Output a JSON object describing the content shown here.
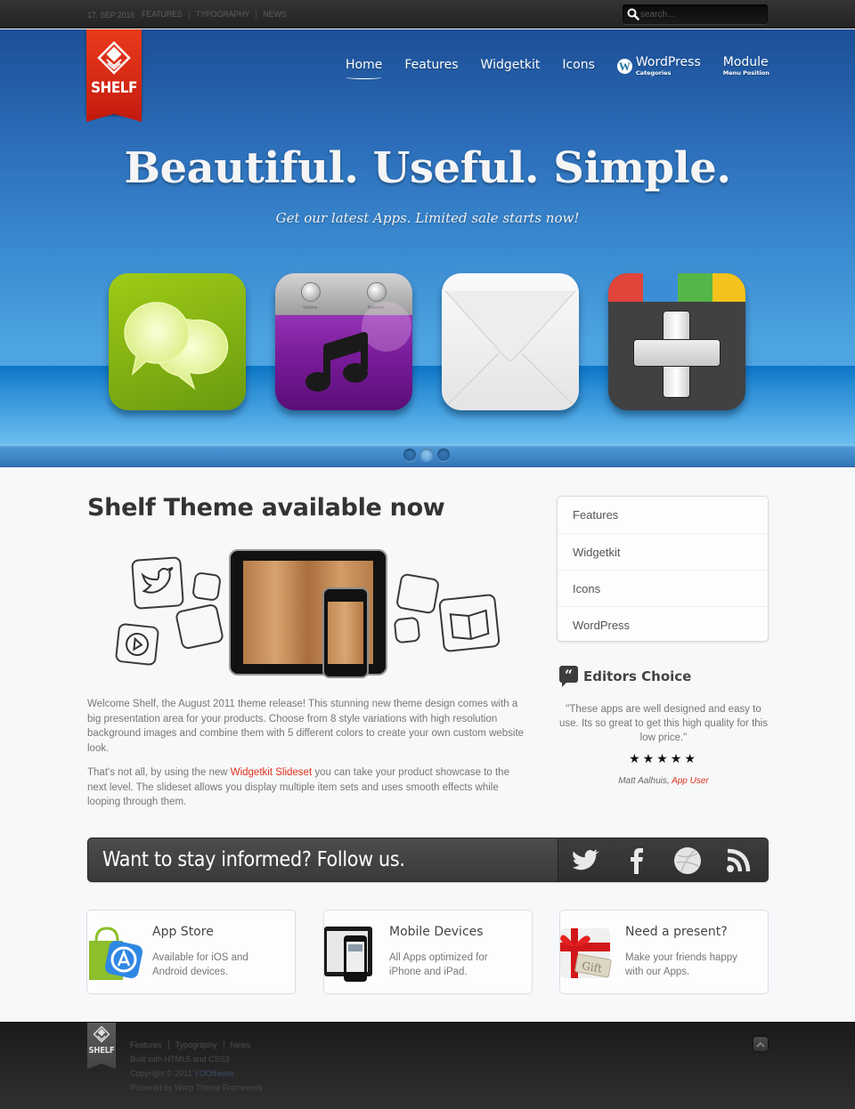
{
  "toolbar": {
    "date": "17. SEP 2016",
    "links": [
      "FEATURES",
      "TYPOGRAPHY",
      "NEWS"
    ],
    "search_placeholder": "search..."
  },
  "logo": {
    "text": "SHELF"
  },
  "nav": {
    "items": [
      {
        "label": "Home",
        "active": true
      },
      {
        "label": "Features"
      },
      {
        "label": "Widgetkit"
      },
      {
        "label": "Icons"
      },
      {
        "label": "WordPress",
        "sub": "Categories",
        "icon": "wordpress-icon"
      },
      {
        "label": "Module",
        "sub": "Menu Position"
      }
    ]
  },
  "hero": {
    "headline": "Beautiful. Useful. Simple.",
    "subline": "Get our latest Apps. Limited sale starts now!",
    "apps": [
      {
        "name": "messages",
        "icon": "speech-bubbles-icon"
      },
      {
        "name": "music",
        "icon": "music-note-icon",
        "knob_labels": [
          "Volume",
          "Balance"
        ]
      },
      {
        "name": "mail",
        "icon": "envelope-icon"
      },
      {
        "name": "google-plus",
        "icon": "plus-icon",
        "bar_colors": [
          "#e0443a",
          "#3b8ed6",
          "#54b548",
          "#f3c21c"
        ]
      }
    ],
    "slides": 3,
    "active_slide": 2
  },
  "main": {
    "title": "Shelf Theme available now",
    "paragraph1": "Welcome Shelf, the August 2011 theme release! This stunning new theme design comes with a big presentation area for your products. Choose from 8 style variations with high resolution background images and combine them with 5 different colors to create your own custom website look.",
    "paragraph2_before": "That's not all, by using the new ",
    "paragraph2_link": "Widgetkit Slideset",
    "paragraph2_after": " you can take your product showcase to the next level. The slideset allows you display multiple item sets and uses smooth effects while looping through them."
  },
  "sidebar": {
    "menu": [
      "Features",
      "Widgetkit",
      "Icons",
      "WordPress"
    ],
    "editors_choice": {
      "title": "Editors Choice",
      "quote": "\"These apps are well designed and easy to use. Its so great to get this high quality for this low price.\"",
      "rating": 5,
      "stars": "★★★★★",
      "author": "Matt Aalhuis,",
      "role": "App User"
    }
  },
  "follow": {
    "text": "Want to stay informed? Follow us.",
    "social": [
      "twitter",
      "facebook",
      "dribbble",
      "rss"
    ]
  },
  "features": [
    {
      "title": "App Store",
      "desc": "Available for iOS and Android devices."
    },
    {
      "title": "Mobile Devices",
      "desc": "All Apps optimized for iPhone and iPad."
    },
    {
      "title": "Need a present?",
      "desc": "Make your friends happy with our Apps.",
      "image_text": "Gift"
    }
  ],
  "footer": {
    "logo_text": "SHELF",
    "links": [
      "Features",
      "Typography",
      "News"
    ],
    "built": "Built with HTML5 and CSS3",
    "copyright_prefix": "Copyright © 2011 ",
    "copyright_brand": "YOOtheme",
    "powered": "Powered by Warp Theme Framework"
  },
  "colors": {
    "accent": "#e1311b",
    "hero_blue": "#3a8ad0",
    "toolbar": "#2b2b2b",
    "footer": "#252525"
  }
}
